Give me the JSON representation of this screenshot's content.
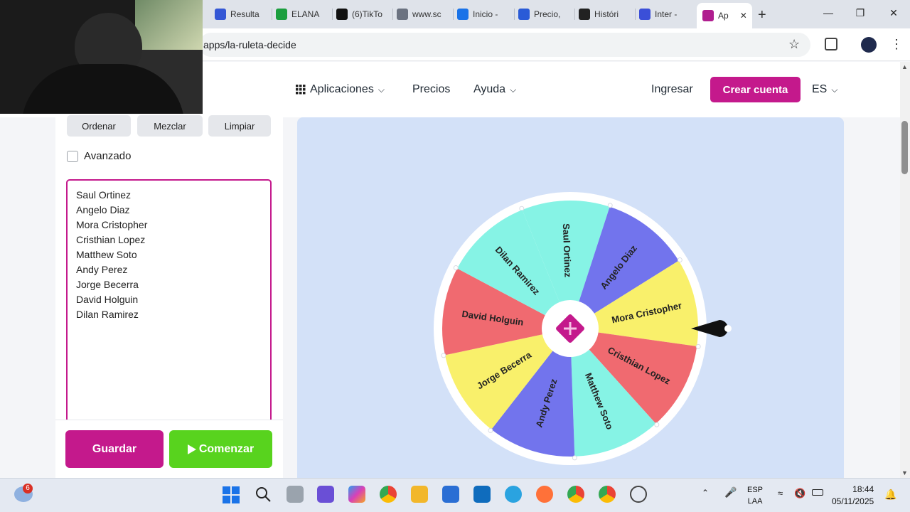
{
  "browser": {
    "tabs": [
      {
        "label": "Resulta",
        "icon": "s-logo-icon",
        "color": "#3457d5"
      },
      {
        "label": "ELANA",
        "icon": "k-logo-icon",
        "color": "#1b9e3e"
      },
      {
        "label": "(6)TikTo",
        "icon": "tiktok-icon",
        "color": "#111111"
      },
      {
        "label": "www.sc",
        "icon": "globe-icon",
        "color": "#6b7280"
      },
      {
        "label": "Inicio -",
        "icon": "edge-icon",
        "color": "#1a73e8"
      },
      {
        "label": "Precio,",
        "icon": "at-icon",
        "color": "#2a5bd7"
      },
      {
        "label": "Históri",
        "icon": "inv-icon",
        "color": "#222222"
      },
      {
        "label": "Inter -",
        "icon": "doc-icon",
        "color": "#3b4fd8"
      },
      {
        "label": "Ap",
        "icon": "app-logo-icon",
        "color": "#b01e8f"
      }
    ],
    "url": "apps/la-ruleta-decide"
  },
  "header": {
    "aplicaciones": "Aplicaciones",
    "precios": "Precios",
    "ayuda": "Ayuda",
    "ingresar": "Ingresar",
    "crear_cuenta": "Crear cuenta",
    "language": "ES"
  },
  "panel": {
    "ordenar": "Ordenar",
    "mezclar": "Mezclar",
    "limpiar": "Limpiar",
    "avanzado": "Avanzado",
    "names": [
      "Saul Ortinez",
      "Angelo Diaz",
      "Mora Cristopher",
      "Cristhian Lopez",
      "Matthew Soto",
      "Andy Perez",
      "Jorge Becerra",
      "David Holguin",
      "Dilan Ramirez"
    ],
    "guardar": "Guardar",
    "comenzar": "Comenzar"
  },
  "wheel": {
    "segments": [
      {
        "label": "Saul Ortinez",
        "color": "#86f3e5"
      },
      {
        "label": "Angelo Diaz",
        "color": "#7274ed"
      },
      {
        "label": "Mora Cristopher",
        "color": "#f9f06b"
      },
      {
        "label": "Cristhian Lopez",
        "color": "#f06a70"
      },
      {
        "label": "Matthew Soto",
        "color": "#86f3e5"
      },
      {
        "label": "Andy Perez",
        "color": "#7274ed"
      },
      {
        "label": "Jorge Becerra",
        "color": "#f9f06b"
      },
      {
        "label": "David Holguin",
        "color": "#f06a70"
      },
      {
        "label": "Dilan Ramirez",
        "color": "#86f3e5"
      }
    ]
  },
  "taskbar": {
    "notification_count": "6",
    "lang_line1": "ESP",
    "lang_line2": "LAA",
    "time": "18:44",
    "date": "05/11/2025"
  },
  "colors": {
    "accent": "#c4198c",
    "start": "#58d31e"
  }
}
